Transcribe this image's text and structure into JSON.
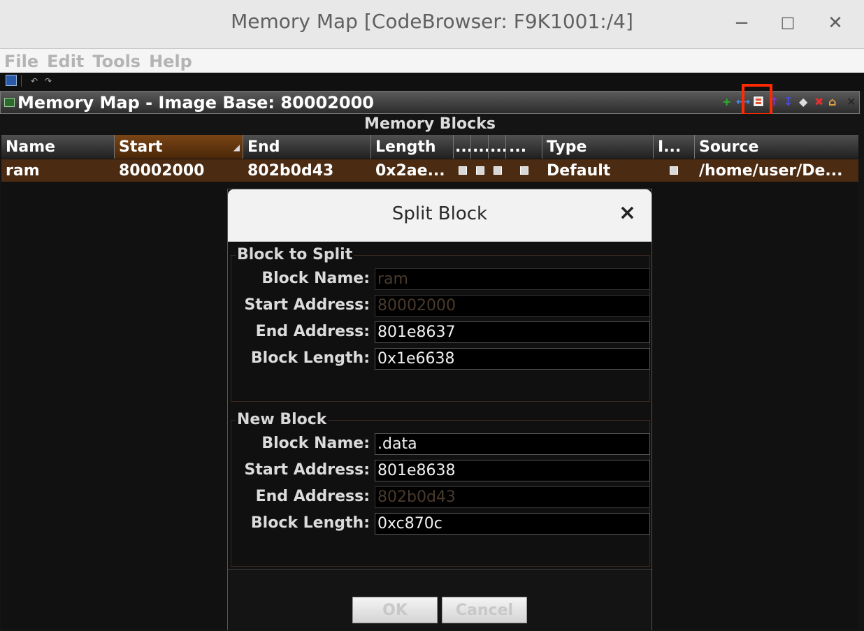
{
  "window": {
    "title": "Memory Map [CodeBrowser: F9K1001:/4]"
  },
  "menu": [
    "File",
    "Edit",
    "Tools",
    "Help"
  ],
  "panel": {
    "title": "Memory Map - Image Base: 80002000",
    "subtitle": "Memory Blocks"
  },
  "table": {
    "columns": [
      "Name",
      "Start",
      "End",
      "Length",
      "...",
      "...",
      "...",
      "...",
      "Type",
      "I...",
      "Source"
    ],
    "rows": [
      {
        "name": "ram",
        "start": "80002000",
        "end": "802b0d43",
        "length": "0x2ae...",
        "type": "Default",
        "source": "/home/user/De..."
      }
    ]
  },
  "dialog": {
    "title": "Split Block",
    "close": "×",
    "block_to_split": {
      "legend": "Block to Split",
      "block_name_label": "Block Name:",
      "block_name": "ram",
      "start_label": "Start Address:",
      "start": "80002000",
      "end_label": "End Address:",
      "end": "801e8637",
      "length_label": "Block Length:",
      "length": "0x1e6638"
    },
    "new_block": {
      "legend": "New Block",
      "block_name_label": "Block Name:",
      "block_name": ".data",
      "start_label": "Start Address:",
      "start": "801e8638",
      "end_label": "End Address:",
      "end": "802b0d43",
      "length_label": "Block Length:",
      "length": "0xc870c"
    },
    "ok_label": "OK",
    "cancel_label": "Cancel"
  },
  "colors": {
    "highlight": "#ff2a00",
    "selected_row": "#4b2b12",
    "sorted_header": "#7a4515"
  }
}
